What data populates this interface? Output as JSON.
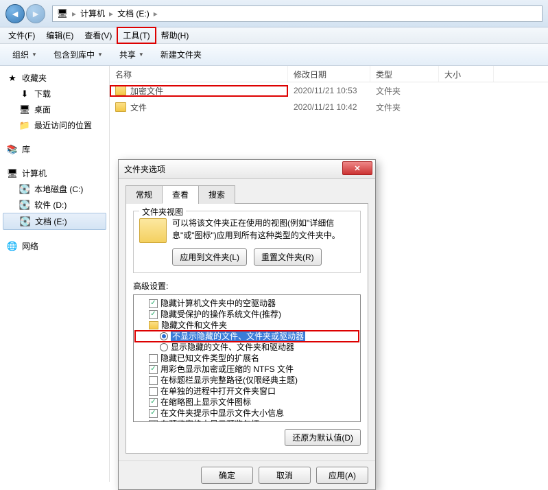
{
  "breadcrumb": {
    "computer": "计算机",
    "drive": "文档 (E:)"
  },
  "menubar": {
    "file": "文件(F)",
    "edit": "编辑(E)",
    "view": "查看(V)",
    "tools": "工具(T)",
    "help": "帮助(H)"
  },
  "toolbar": {
    "organize": "组织",
    "include": "包含到库中",
    "share": "共享",
    "newfolder": "新建文件夹"
  },
  "sidebar": {
    "favorites": {
      "header": "收藏夹",
      "downloads": "下载",
      "desktop": "桌面",
      "recent": "最近访问的位置"
    },
    "libraries": {
      "header": "库"
    },
    "computer": {
      "header": "计算机",
      "drive_c": "本地磁盘 (C:)",
      "drive_d": "软件 (D:)",
      "drive_e": "文档 (E:)"
    },
    "network": {
      "header": "网络"
    }
  },
  "columns": {
    "name": "名称",
    "date": "修改日期",
    "type": "类型",
    "size": "大小"
  },
  "rows": [
    {
      "name": "加密文件",
      "date": "2020/11/21 10:53",
      "type": "文件夹"
    },
    {
      "name": "文件",
      "date": "2020/11/21 10:42",
      "type": "文件夹"
    }
  ],
  "dialog": {
    "title": "文件夹选项",
    "tabs": {
      "general": "常规",
      "view": "查看",
      "search": "搜索"
    },
    "group": {
      "title": "文件夹视图",
      "desc": "可以将该文件夹正在使用的视图(例如\"详细信息\"或\"图标\")应用到所有这种类型的文件夹中。",
      "apply": "应用到文件夹(L)",
      "reset": "重置文件夹(R)"
    },
    "advanced_label": "高级设置:",
    "tree": {
      "n0": "隐藏计算机文件夹中的空驱动器",
      "n1": "隐藏受保护的操作系统文件(推荐)",
      "n2": "隐藏文件和文件夹",
      "n3": "不显示隐藏的文件、文件夹或驱动器",
      "n4": "显示隐藏的文件、文件夹和驱动器",
      "n5": "隐藏已知文件类型的扩展名",
      "n6": "用彩色显示加密或压缩的 NTFS 文件",
      "n7": "在标题栏显示完整路径(仅限经典主题)",
      "n8": "在单独的进程中打开文件夹窗口",
      "n9": "在缩略图上显示文件图标",
      "n10": "在文件夹提示中显示文件大小信息",
      "n11": "在预览窗格中显示预览句柄"
    },
    "restore": "还原为默认值(D)",
    "ok": "确定",
    "cancel": "取消",
    "apply_btn": "应用(A)"
  }
}
